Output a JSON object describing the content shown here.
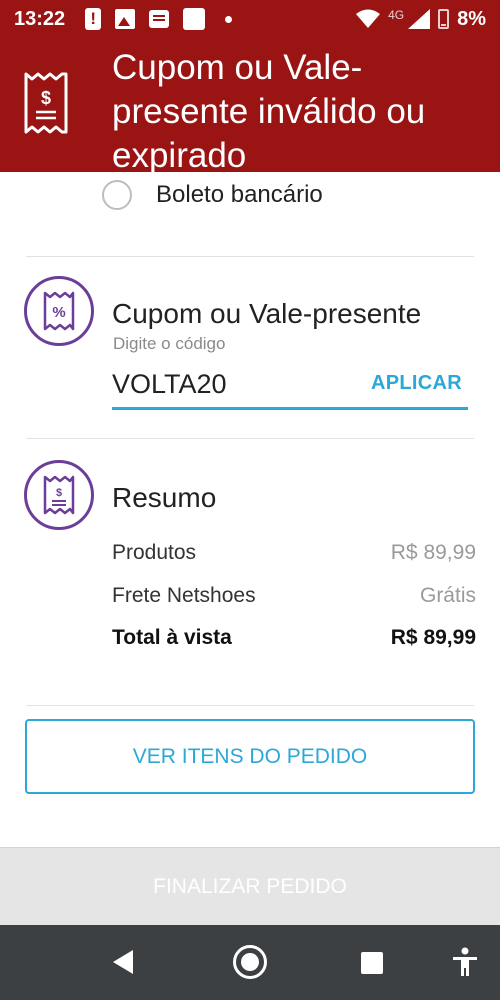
{
  "status_bar": {
    "time": "13:22",
    "network": "4G",
    "battery": "8%"
  },
  "banner": {
    "message": "Cupom ou Vale-presente inválido ou expirado",
    "icon": "receipt-dollar-icon"
  },
  "payment": {
    "option_label": "Boleto bancário"
  },
  "coupon": {
    "title": "Cupom ou Vale-presente",
    "hint": "Digite o código",
    "value": "VOLTA20",
    "apply_label": "APLICAR",
    "icon": "coupon-percent-icon"
  },
  "summary": {
    "title": "Resumo",
    "icon": "receipt-icon",
    "rows": [
      {
        "label": "Produtos",
        "value": "R$ 89,99"
      },
      {
        "label": "Frete Netshoes",
        "value": "Grátis"
      },
      {
        "label": "Total à vista",
        "value": "R$ 89,99"
      }
    ]
  },
  "actions": {
    "view_items_label": "VER ITENS DO PEDIDO",
    "finalize_label": "FINALIZAR PEDIDO"
  },
  "colors": {
    "banner": "#9a1414",
    "accent": "#2aa8d8",
    "icon_purple": "#6b3f99"
  }
}
